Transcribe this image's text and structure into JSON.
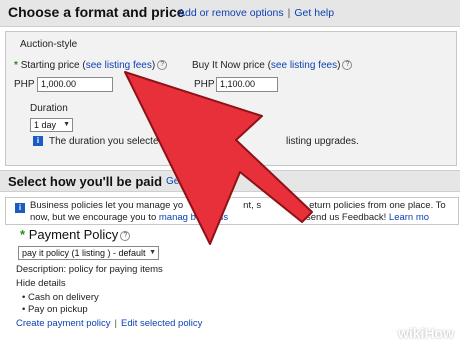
{
  "header": {
    "title": "Choose a format and price",
    "add_remove_options": "Add or remove options",
    "get_help": "Get help"
  },
  "auction": {
    "legend": "Auction-style",
    "starting_price_label": "Starting price (",
    "see_fees": "see listing fees",
    "close_paren": ")",
    "currency": "PHP",
    "starting_price_value": "1,000.00",
    "buy_now_label": "Buy It Now price (",
    "buy_now_value": "1,100.00",
    "duration_label": "Duration",
    "duration_value": "1 day",
    "duration_note_start": "The duration you selecte",
    "duration_note_end": "listing upgrades."
  },
  "payment_section": {
    "title": "Select how you'll be paid",
    "partial_link": "Ge",
    "notice_line1_start": "Business policies let you manage yo",
    "notice_line1_mid": "nt, s",
    "notice_line1_end": "eturn policies from one place. To",
    "notice_line2_start": "now, but we encourage you to",
    "notice_link": "manag",
    "notice_link2": "business",
    "notice_line2_end": "d send us Feedback!",
    "learn_more": "Learn mo"
  },
  "payment_policy": {
    "title": "Payment Policy",
    "selected": "pay it policy (1 listing ) - default",
    "description": "Description: policy for paying items",
    "hide_details": "Hide details",
    "items": [
      "Cash on delivery",
      "Pay on pickup"
    ],
    "create_link": "Create payment policy",
    "edit_link": "Edit selected policy"
  },
  "watermark": {
    "wiki": "wiki",
    "how": "How"
  },
  "colors": {
    "arrow": "#e8303a",
    "link": "#0d41b5",
    "info": "#1a5bc4",
    "header_bg": "#e6e6e6"
  }
}
